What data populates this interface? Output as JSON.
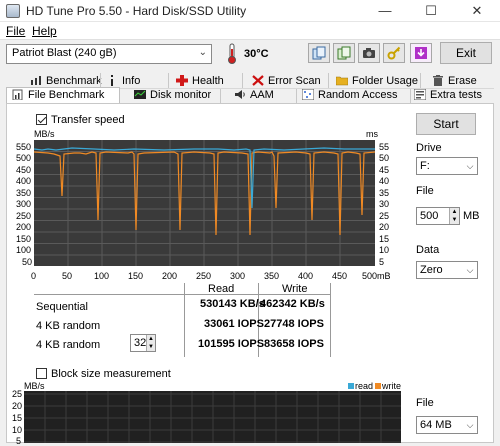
{
  "window": {
    "title": "HD Tune Pro 5.50 - Hard Disk/SSD Utility",
    "min": "—",
    "max": "☐",
    "close": "✕"
  },
  "menu": {
    "file": "File",
    "help": "Help"
  },
  "toolbar": {
    "drive": "Patriot Blast (240 gB)",
    "temp_value": "30",
    "temp_unit": "°C",
    "exit": "Exit"
  },
  "tabs_row1": [
    "Benchmark",
    "Info",
    "Health",
    "Error Scan",
    "Folder Usage",
    "Erase"
  ],
  "tabs_row2": [
    "File Benchmark",
    "Disk monitor",
    "AAM",
    "Random Access",
    "Extra tests"
  ],
  "benchmark": {
    "transfer_speed": "Transfer speed",
    "left_unit": "MB/s",
    "right_unit": "ms",
    "left_ticks": [
      "550",
      "500",
      "450",
      "400",
      "350",
      "300",
      "250",
      "200",
      "150",
      "100",
      "50"
    ],
    "right_ticks": [
      "55",
      "50",
      "45",
      "40",
      "35",
      "30",
      "25",
      "20",
      "15",
      "10",
      "5"
    ],
    "x_ticks": [
      "0",
      "50",
      "100",
      "150",
      "200",
      "250",
      "300",
      "350",
      "400",
      "450",
      "500mB"
    ]
  },
  "results": {
    "col_read": "Read",
    "col_write": "Write",
    "rows": [
      {
        "label": "Sequential",
        "read": "530143 KB/s",
        "write": "462342 KB/s"
      },
      {
        "label": "4 KB random",
        "read": "33061 IOPS",
        "write": "27748 IOPS"
      },
      {
        "label": "4 KB random",
        "read": "101595 IOPS",
        "write": "83658 IOPS"
      }
    ],
    "queue_depth": "32"
  },
  "side": {
    "start": "Start",
    "drive_label": "Drive",
    "drive_value": "F:",
    "file_label": "File",
    "file_value": "500",
    "file_unit": "MB",
    "data_label": "Data",
    "data_value": "Zero",
    "file2_label": "File",
    "file2_value": "64 MB"
  },
  "block": {
    "label": "Block size measurement",
    "unit": "MB/s",
    "ticks": [
      "25",
      "20",
      "15",
      "10",
      "5"
    ],
    "legend_read": "read",
    "legend_write": "write"
  },
  "colors": {
    "read": "#3aa9d6",
    "write": "#f08a24",
    "plot_bg": "#3a3a3a"
  }
}
